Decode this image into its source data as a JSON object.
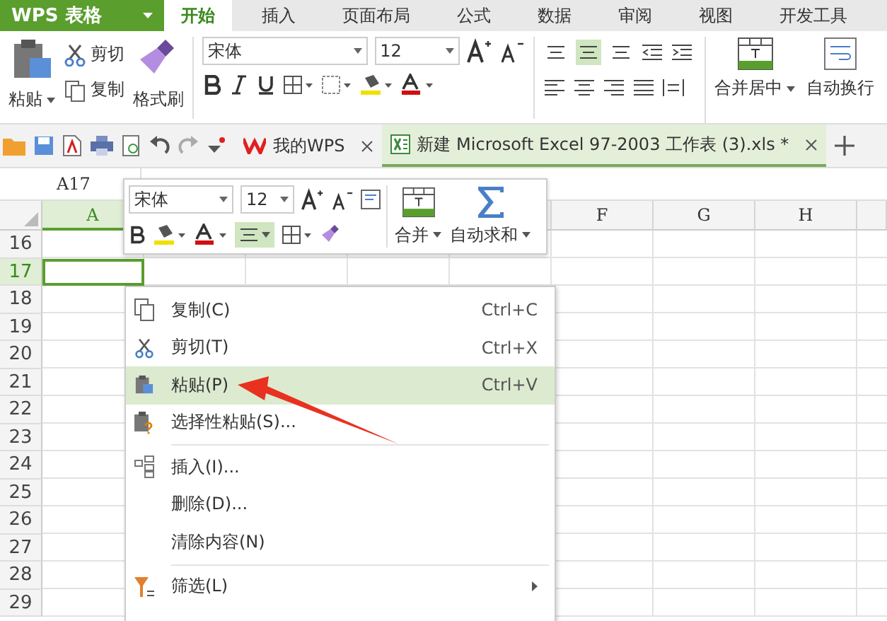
{
  "app_menu": {
    "label": "WPS 表格"
  },
  "ribbon_tabs": [
    {
      "label": "开始",
      "selected": true
    },
    {
      "label": "插入",
      "selected": false
    },
    {
      "label": "页面布局",
      "selected": false
    },
    {
      "label": "公式",
      "selected": false
    },
    {
      "label": "数据",
      "selected": false
    },
    {
      "label": "审阅",
      "selected": false
    },
    {
      "label": "视图",
      "selected": false
    },
    {
      "label": "开发工具",
      "selected": false
    }
  ],
  "ribbon": {
    "paste": "粘贴",
    "cut": "剪切",
    "copy": "复制",
    "format_painter": "格式刷",
    "font": "宋体",
    "font_size": "12",
    "merge": "合并居中",
    "wrap": "自动换行",
    "align_buttons": [
      {
        "selected": false
      },
      {
        "selected": true
      },
      {
        "selected": false
      }
    ]
  },
  "doc_tabs": [
    {
      "label": "我的WPS",
      "kind": "home",
      "selected": false
    },
    {
      "label": "新建 Microsoft Excel 97-2003 工作表 (3).xls *",
      "kind": "sheet",
      "selected": true
    }
  ],
  "name_box": "A17",
  "columns": [
    {
      "label": "A",
      "selected": true
    },
    {
      "label": "F",
      "selected": false
    },
    {
      "label": "G",
      "selected": false
    },
    {
      "label": "H",
      "selected": false
    }
  ],
  "rows": [
    {
      "label": "16",
      "selected": false
    },
    {
      "label": "17",
      "selected": true
    },
    {
      "label": "18",
      "selected": false
    },
    {
      "label": "19",
      "selected": false
    },
    {
      "label": "20",
      "selected": false
    },
    {
      "label": "21",
      "selected": false
    },
    {
      "label": "22",
      "selected": false
    },
    {
      "label": "23",
      "selected": false
    },
    {
      "label": "24",
      "selected": false
    },
    {
      "label": "25",
      "selected": false
    },
    {
      "label": "26",
      "selected": false
    },
    {
      "label": "27",
      "selected": false
    },
    {
      "label": "28",
      "selected": false
    },
    {
      "label": "29",
      "selected": false
    }
  ],
  "mini_toolbar": {
    "font": "宋体",
    "font_size": "12",
    "align_selected": true,
    "merge": "合并",
    "autosum": "自动求和"
  },
  "context_menu": [
    {
      "label": "复制(C)",
      "shortcut": "Ctrl+C",
      "kind": "item",
      "selected": false,
      "separator_before": false
    },
    {
      "label": "剪切(T)",
      "shortcut": "Ctrl+X",
      "kind": "item",
      "selected": false,
      "separator_before": false
    },
    {
      "label": "粘贴(P)",
      "shortcut": "Ctrl+V",
      "kind": "item",
      "selected": true,
      "separator_before": false
    },
    {
      "label": "选择性粘贴(S)...",
      "kind": "item",
      "selected": false,
      "separator_before": false
    },
    {
      "label": "插入(I)...",
      "kind": "item",
      "selected": false,
      "separator_before": true
    },
    {
      "label": "删除(D)...",
      "kind": "item",
      "selected": false,
      "separator_before": false
    },
    {
      "label": "清除内容(N)",
      "kind": "item",
      "selected": false,
      "separator_before": false
    },
    {
      "label": "筛选(L)",
      "kind": "submenu",
      "selected": false,
      "separator_before": true
    }
  ]
}
